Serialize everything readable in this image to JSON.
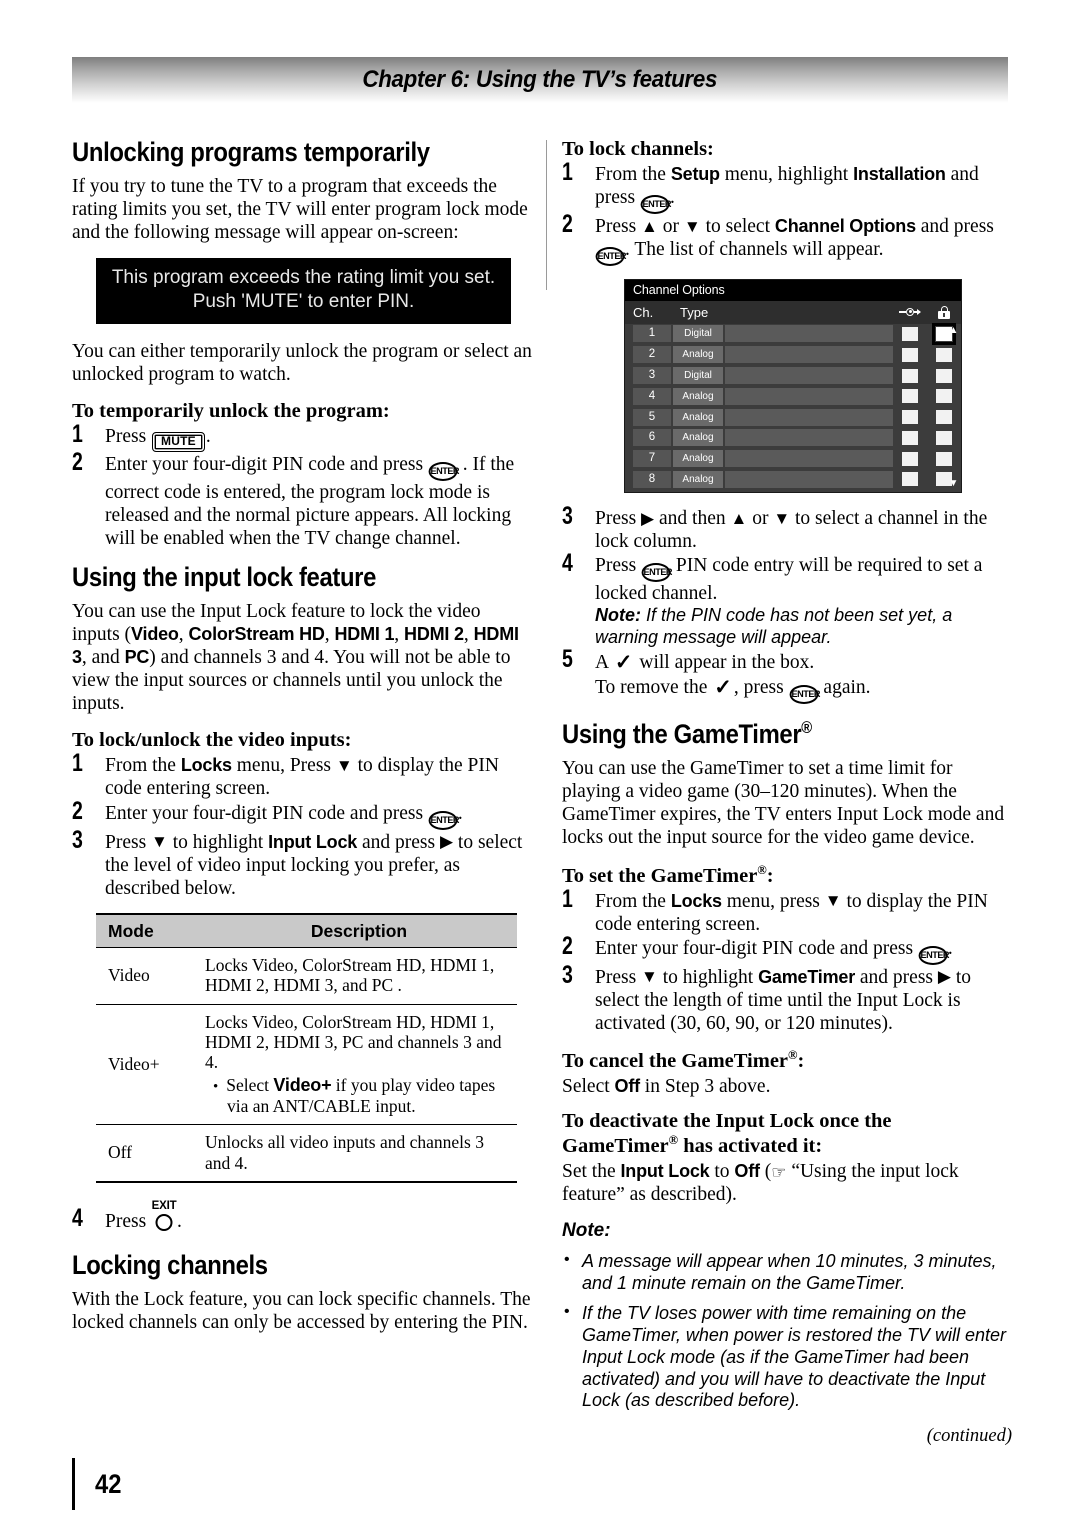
{
  "header": {
    "chapter_title": "Chapter 6: Using the TV’s features"
  },
  "footer": {
    "page_number": "42"
  },
  "left": {
    "h_unlocking": "Unlocking programs temporarily",
    "p_intro": "If you try to tune the TV to a program that exceeds the rating limits you set, the TV will enter program lock mode and the following message will appear on-screen:",
    "osd_message_line1": "This program exceeds the rating limit you set.",
    "osd_message_line2": "Push 'MUTE' to enter PIN.",
    "p_either": "You can either temporarily unlock the program or select an unlocked program to watch.",
    "h_temp_unlock": "To temporarily unlock the program:",
    "step1_press": "Press",
    "step1_key": "MUTE",
    "step1_end": ".",
    "step2_a": "Enter your four-digit PIN code and press",
    "step2_key": "ENTER",
    "step2_b": ". If the correct code is entered, the program lock mode is released and the normal picture appears. All locking will be enabled when the TV change channel.",
    "h_input_lock": "Using the input lock feature",
    "p_inputlock_1": "You can use the Input Lock feature to lock the video inputs (",
    "inputs": [
      "Video",
      "ColorStream HD",
      "HDMI 1",
      "HDMI 2",
      "HDMI 3",
      "PC"
    ],
    "p_inputlock_2": ") and channels 3 and 4. You will not be able to view the input sources or channels until you unlock the inputs.",
    "h_lockunlock": "To lock/unlock the video inputs:",
    "s1_a": "From the",
    "s1_menu": "Locks",
    "s1_b": "menu, Press",
    "s1_c": "to display the PIN code entering screen.",
    "s2_a": "Enter your four-digit PIN code and press",
    "s2_key": "ENTER",
    "s2_b": ".",
    "s3_a": "Press",
    "s3_b": "to highlight",
    "s3_item": "Input Lock",
    "s3_c": "and press",
    "s3_d": "to select the level of video input locking you prefer, as described below.",
    "table": {
      "headers": [
        "Mode",
        "Description"
      ],
      "rows": [
        {
          "mode": "Video",
          "desc": "Locks Video, ColorStream HD, HDMI 1, HDMI 2, HDMI 3, and PC ."
        },
        {
          "mode": "Video+",
          "desc": "Locks Video, ColorStream HD, HDMI 1, HDMI 2, HDMI 3, PC and channels 3 and 4.",
          "bullet_pre": "Select",
          "bullet_ui": "Video+",
          "bullet_post": "if you play video tapes via an ANT/CABLE input."
        },
        {
          "mode": "Off",
          "desc": "Unlocks all video inputs and channels 3 and 4."
        }
      ]
    },
    "s4_a": "Press",
    "s4_key": "EXIT",
    "s4_b": ".",
    "h_locking_channels": "Locking channels",
    "p_locking_channels": "With the Lock feature, you can lock specific channels. The locked channels can only be accessed by entering the PIN."
  },
  "right": {
    "h_lock_channels": "To lock channels:",
    "r1_a": "From the",
    "r1_menu": "Setup",
    "r1_b": "menu, highlight",
    "r1_item": "Installation",
    "r1_c": "and press",
    "r1_key": "ENTER",
    "r1_d": ".",
    "r2_a": "Press",
    "r2_b": "or",
    "r2_c": "to select",
    "r2_item": "Channel Options",
    "r2_d": "and press",
    "r2_key": "ENTER",
    "r2_e": ". The list of channels will appear.",
    "osd": {
      "title": "Channel Options",
      "col_ch": "Ch.",
      "col_type": "Type",
      "icon_skip": "skip-icon",
      "icon_lock": "lock-icon",
      "scroll_up": "▲",
      "scroll_down": "▼",
      "rows": [
        {
          "ch": "1",
          "type": "Digital",
          "skip_checked": false,
          "lock_checked": false,
          "lock_selected": true
        },
        {
          "ch": "2",
          "type": "Analog",
          "skip_checked": false,
          "lock_checked": false,
          "lock_selected": false
        },
        {
          "ch": "3",
          "type": "Digital",
          "skip_checked": false,
          "lock_checked": false,
          "lock_selected": false
        },
        {
          "ch": "4",
          "type": "Analog",
          "skip_checked": false,
          "lock_checked": false,
          "lock_selected": false
        },
        {
          "ch": "5",
          "type": "Analog",
          "skip_checked": false,
          "lock_checked": false,
          "lock_selected": false
        },
        {
          "ch": "6",
          "type": "Analog",
          "skip_checked": false,
          "lock_checked": false,
          "lock_selected": false
        },
        {
          "ch": "7",
          "type": "Analog",
          "skip_checked": false,
          "lock_checked": false,
          "lock_selected": false
        },
        {
          "ch": "8",
          "type": "Analog",
          "skip_checked": false,
          "lock_checked": false,
          "lock_selected": false
        }
      ]
    },
    "r3_a": "Press",
    "r3_b": "and then",
    "r3_c": "or",
    "r3_d": "to select a channel in the lock column.",
    "r4_a": "Press",
    "r4_key": "ENTER",
    "r4_b": "PIN code entry will be required to set a locked channel.",
    "r4_note_label": "Note:",
    "r4_note": "If the PIN code has not been set yet, a warning message will appear.",
    "r5_a": "A",
    "r5_b": "will appear in the box.",
    "r5_c": "To remove the",
    "r5_d": ", press",
    "r5_key": "ENTER",
    "r5_e": "again.",
    "h_gametimer": "Using the GameTimer",
    "p_gametimer": "You can use the GameTimer to set a time limit for playing a video game (30–120 minutes). When the GameTimer expires, the TV enters Input Lock mode and locks out the input source for the video game device.",
    "h_set_gametimer": "To set the GameTimer",
    "g1_a": "From the",
    "g1_menu": "Locks",
    "g1_b": "menu, press",
    "g1_c": "to display the PIN code entering screen.",
    "g2_a": "Enter your four-digit PIN code and press",
    "g2_key": "ENTER",
    "g2_b": ".",
    "g3_a": "Press",
    "g3_b": "to highlight",
    "g3_item": "GameTimer",
    "g3_c": "and press",
    "g3_d": "to select the length of time until the Input Lock is activated (30, 60, 90, or 120 minutes).",
    "h_cancel_gametimer": "To cancel the GameTimer",
    "p_cancel_a": "Select",
    "p_cancel_ui": "Off",
    "p_cancel_b": "in Step 3 above.",
    "h_deactivate_1": "To deactivate the Input Lock once the",
    "h_deactivate_2a": "GameTimer",
    "h_deactivate_2b": "has activated it:",
    "p_deact_a": "Set the",
    "p_deact_ui1": "Input Lock",
    "p_deact_b": "to",
    "p_deact_ui2": "Off",
    "p_deact_c": "(",
    "p_deact_hand": "☞",
    "p_deact_d": "“Using the input lock feature” as described).",
    "note_label": "Note:",
    "notes": [
      "A message will appear when 10 minutes, 3 minutes, and 1 minute remain on the GameTimer.",
      "If the TV loses power with time remaining on the GameTimer, when power is restored the TV will enter Input Lock mode (as if the GameTimer had been activated) and you will have to deactivate the Input Lock (as described before)."
    ],
    "continued": "(continued)"
  }
}
